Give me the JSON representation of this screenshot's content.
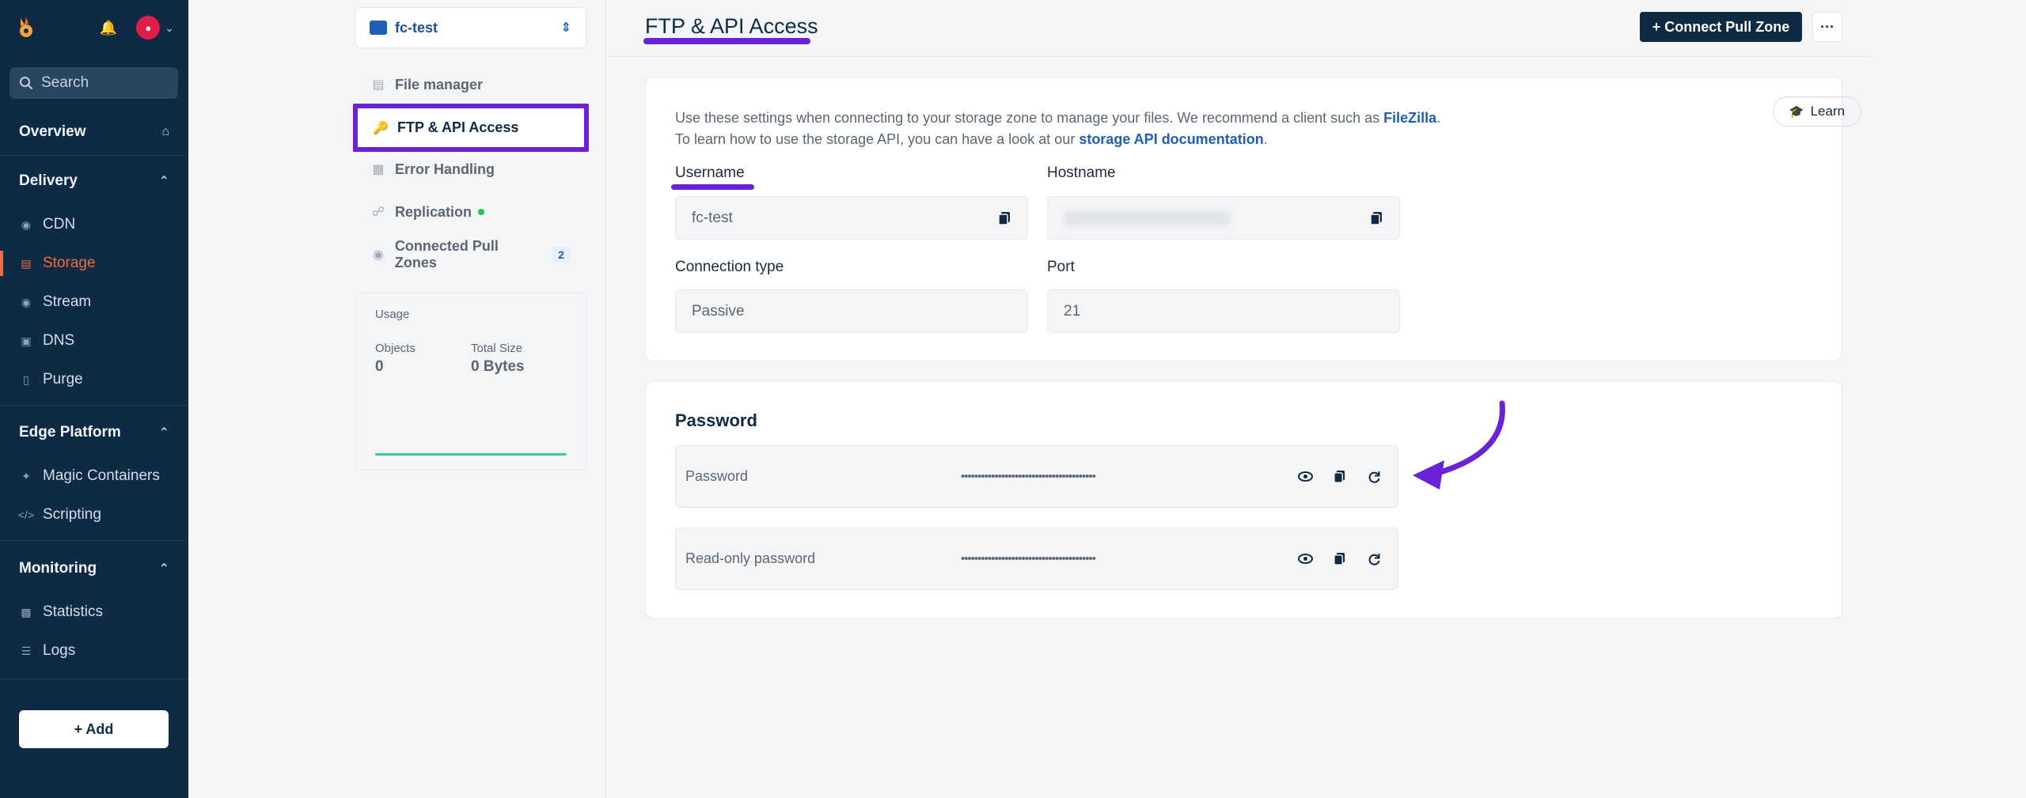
{
  "sidebar": {
    "search_placeholder": "Search",
    "overview": "Overview",
    "sections": [
      {
        "label": "Delivery",
        "items": [
          {
            "label": "CDN",
            "icon": "location-pin-icon"
          },
          {
            "label": "Storage",
            "icon": "storage-icon",
            "active": true
          },
          {
            "label": "Stream",
            "icon": "play-icon"
          },
          {
            "label": "DNS",
            "icon": "dns-icon"
          },
          {
            "label": "Purge",
            "icon": "trash-icon"
          }
        ]
      },
      {
        "label": "Edge Platform",
        "items": [
          {
            "label": "Magic Containers",
            "icon": "magic-wand-icon"
          },
          {
            "label": "Scripting",
            "icon": "code-icon"
          }
        ]
      },
      {
        "label": "Monitoring",
        "items": [
          {
            "label": "Statistics",
            "icon": "bar-chart-icon"
          },
          {
            "label": "Logs",
            "icon": "list-icon"
          }
        ]
      }
    ],
    "add_label": "+ Add"
  },
  "zone": {
    "name": "fc-test",
    "nav": [
      {
        "label": "File manager",
        "icon": "file-icon"
      },
      {
        "label": "FTP & API Access",
        "icon": "key-icon",
        "active": true
      },
      {
        "label": "Error Handling",
        "icon": "alert-icon"
      },
      {
        "label": "Replication",
        "icon": "replication-icon"
      },
      {
        "label": "Connected Pull Zones",
        "icon": "pin-icon",
        "badge": "2"
      }
    ],
    "usage": {
      "title": "Usage",
      "objects_label": "Objects",
      "objects_value": "0",
      "size_label": "Total Size",
      "size_value": "0 Bytes"
    }
  },
  "header": {
    "title": "FTP & API Access",
    "connect_label": "+ Connect Pull Zone",
    "more_label": "···"
  },
  "ftp": {
    "desc_pre": "Use these settings when connecting to your storage zone to manage your files. We recommend a client such as ",
    "desc_link1": "FileZilla",
    "desc_mid": ". To learn how to use the storage API, you can have a look at our ",
    "desc_link2": "storage API documentation",
    "desc_post": ".",
    "learn_label": "Learn",
    "username_label": "Username",
    "username_value": "fc-test",
    "hostname_label": "Hostname",
    "conn_type_label": "Connection type",
    "conn_type_value": "Passive",
    "port_label": "Port",
    "port_value": "21"
  },
  "password": {
    "heading": "Password",
    "rows": [
      {
        "label": "Password",
        "masked": "••••••••••••••••••••••••••••••••••••••••"
      },
      {
        "label": "Read-only password",
        "masked": "••••••••••••••••••••••••••••••••••••••••"
      }
    ]
  },
  "colors": {
    "sidebar_bg": "#0f2a44",
    "accent_orange": "#f26b3a",
    "highlight_purple": "#6b21d8",
    "link_blue": "#1d5fb3"
  }
}
